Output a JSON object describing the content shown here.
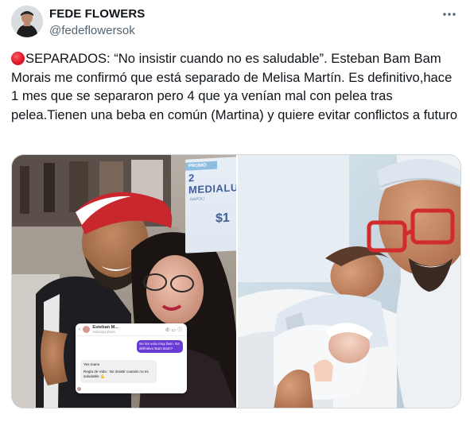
{
  "author": {
    "display_name": "FEDE FLOWERS",
    "handle": "@fedeflowersok",
    "avatar_icon": "user-avatar"
  },
  "menu": {
    "more_label": "···",
    "icon": "more-horizontal-icon"
  },
  "tweet": {
    "status_emoji": "red-circle",
    "text": "SEPARADOS: “No insistir cuando no es saludable”. Esteban Bam Bam Morais me confirmó que está separado de Melisa Martín. Es definitivo,hace 1 mes que se separaron pero 4 que ya venían mal con pelea tras pelea.Tienen una beba en común (Martina) y quiere evitar conflictos a futuro"
  },
  "media": {
    "left_photo": {
      "chat": {
        "contact_name": "Esteban M...",
        "contact_status": "Activo(a) ahora",
        "outgoing_message": "Se los veía muy bien. Es definitivo Bam Bam?",
        "incoming_greeting": "Yes mann",
        "incoming_message": "Regla de Vida : No insistir cuando no es saludable 💪"
      },
      "promo": {
        "banner": "PROMO",
        "title": "2 MEDIALU",
        "sub": "NAPOLI",
        "price": "$1"
      }
    },
    "right_photo": {}
  },
  "colors": {
    "text": "#0f1419",
    "secondary": "#536471",
    "red_dot": "#e0192b",
    "border": "#cfd9de",
    "chat_accent": "#6b3bd6"
  }
}
